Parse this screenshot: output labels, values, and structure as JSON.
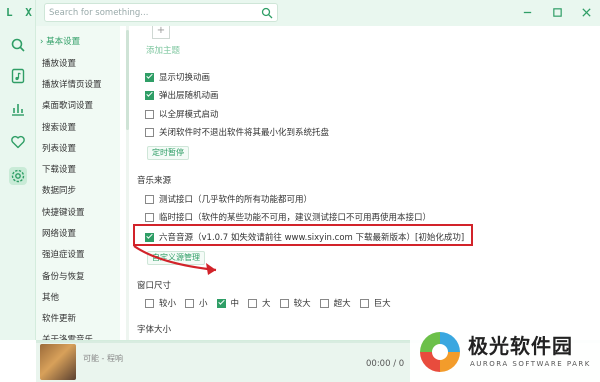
{
  "app": {
    "logo": "L X"
  },
  "search": {
    "placeholder": "Search for something..."
  },
  "nav": {
    "active_marker": "›",
    "items": [
      "基本设置",
      "播放设置",
      "播放详情页设置",
      "桌面歌词设置",
      "搜索设置",
      "列表设置",
      "下载设置",
      "数据同步",
      "快捷键设置",
      "网络设置",
      "强迫症设置",
      "备份与恢复",
      "其他",
      "软件更新",
      "关于洛雪音乐"
    ]
  },
  "theme": {
    "add_label": "添加主题"
  },
  "display_options": [
    {
      "label": "显示切换动画",
      "checked": true
    },
    {
      "label": "弹出层随机动画",
      "checked": true
    },
    {
      "label": "以全屏模式启动",
      "checked": false
    },
    {
      "label": "关闭软件时不退出软件将其最小化到系统托盘",
      "checked": false
    }
  ],
  "timer_button": "定时暂停",
  "music_source": {
    "title": "音乐来源",
    "options": [
      {
        "label": "测试接口（几乎软件的所有功能都可用）",
        "checked": false
      },
      {
        "label": "临时接口（软件的某些功能不可用，建议测试接口不可用再使用本接口）",
        "checked": false
      },
      {
        "label": "六音音源（v1.0.7 如失效请前往 www.sixyin.com 下载最新版本）[初始化成功]",
        "checked": true
      }
    ],
    "custom_link": "自定义源管理"
  },
  "window_size": {
    "title": "窗口尺寸",
    "options": [
      {
        "label": "较小",
        "checked": false
      },
      {
        "label": "小",
        "checked": false
      },
      {
        "label": "中",
        "checked": true
      },
      {
        "label": "大",
        "checked": false
      },
      {
        "label": "较大",
        "checked": false
      },
      {
        "label": "超大",
        "checked": false
      },
      {
        "label": "巨大",
        "checked": false
      }
    ]
  },
  "font_size": {
    "title": "字体大小"
  },
  "player": {
    "song": "可能 - 程响",
    "time": "00:00 / 0"
  },
  "watermark": {
    "cn": "极光软件园",
    "en": "AURORA SOFTWARE PARK"
  },
  "colors": {
    "accent": "#2f9e66",
    "highlight": "#d2232a"
  },
  "icons": {
    "rail": [
      "search-icon",
      "music-file-icon",
      "chart-icon",
      "heart-icon",
      "settings-icon"
    ]
  }
}
